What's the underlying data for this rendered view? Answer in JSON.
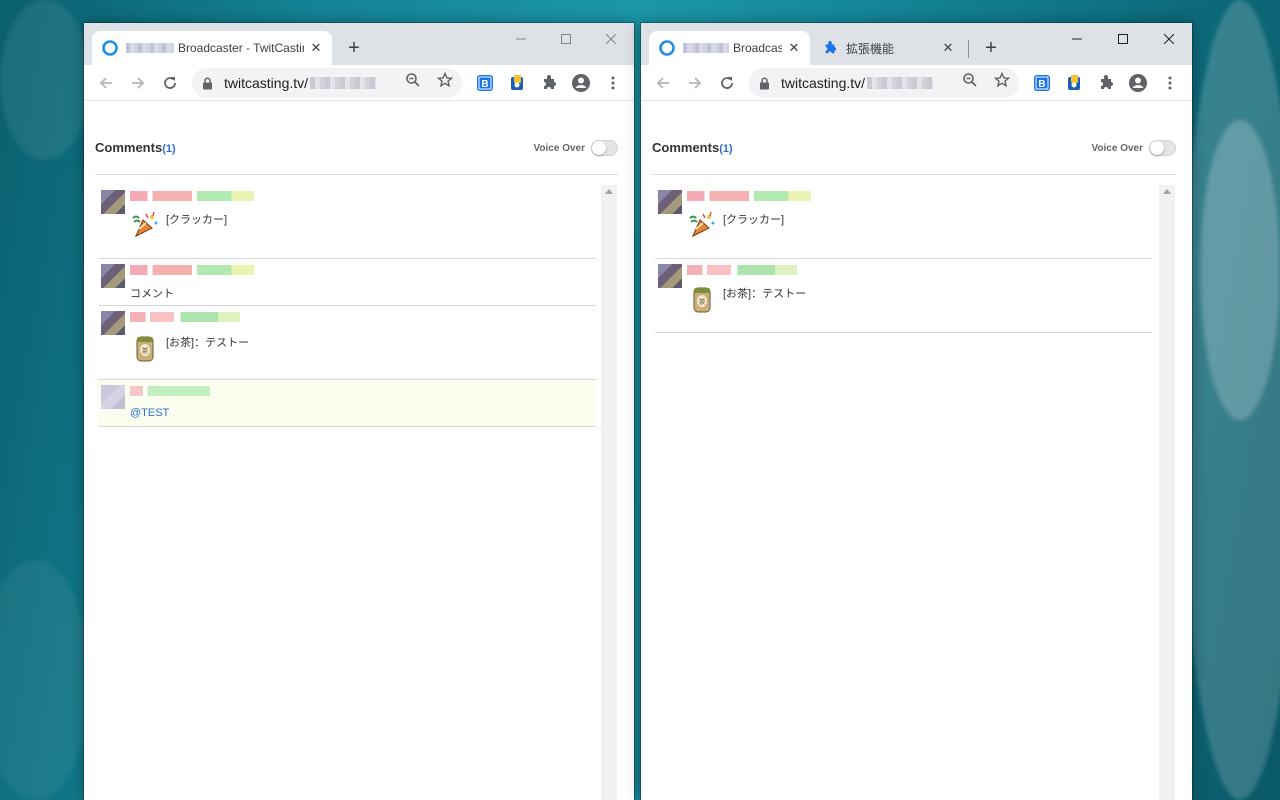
{
  "left_window": {
    "tab_title": "Broadcaster - TwitCasting",
    "url": "twitcasting.tv/",
    "comments_title": "Comments",
    "comments_count": "(1)",
    "voice_over": "Voice Over",
    "comments": [
      {
        "type": "item",
        "icon": "cracker-icon",
        "text": "[クラッカー]"
      },
      {
        "type": "text",
        "text": "コメント"
      },
      {
        "type": "item",
        "icon": "tea-icon",
        "text": "[お茶]：テストー"
      },
      {
        "type": "mention",
        "text": "@TEST"
      }
    ]
  },
  "right_window": {
    "tab1_title": "Broadcaster",
    "tab2_title": "拡張機能",
    "url": "twitcasting.tv/",
    "comments_title": "Comments",
    "comments_count": "(1)",
    "voice_over": "Voice Over",
    "comments": [
      {
        "type": "item",
        "icon": "cracker-icon",
        "text": "[クラッカー]"
      },
      {
        "type": "item",
        "icon": "tea-icon",
        "text": "[お茶]：テストー"
      }
    ]
  },
  "icons": {
    "back": "arrow-left-icon",
    "forward": "arrow-right-icon",
    "reload": "reload-icon",
    "zoom": "zoom-icon",
    "bookmark": "star-icon",
    "extensions": "puzzle-icon",
    "profile": "account-icon",
    "menu": "kebab-menu-icon"
  },
  "colors": {
    "accent_link": "#2d6fcf",
    "tabstrip": "#dee1e6",
    "mention_bg": "#fbfdee"
  }
}
